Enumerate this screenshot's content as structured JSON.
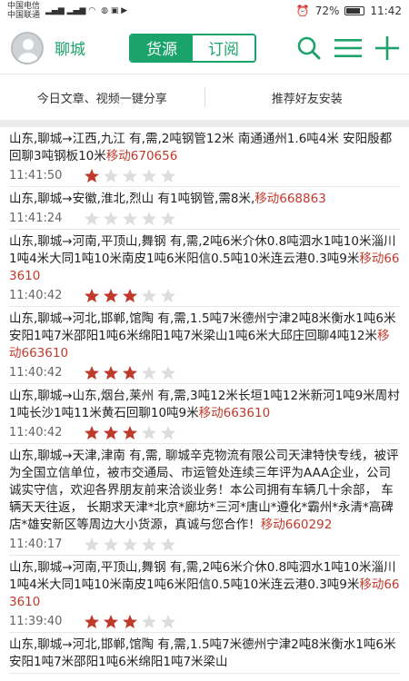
{
  "status_bar": {
    "carrier1": "中国电信",
    "carrier2": "中国联通",
    "battery": "72%",
    "time": "11:42"
  },
  "header": {
    "city": "聊城",
    "tabs": [
      "货源",
      "订阅"
    ],
    "active_tab": 0,
    "icons": [
      "search-icon",
      "menu-icon",
      "add-icon"
    ]
  },
  "share_bar": {
    "left": "今日文章、视频一键分享",
    "right": "推荐好友安装"
  },
  "feed": [
    {
      "text": "山东,聊城→江西,九江 有,需,2吨钢管12米 南通通州1.6吨4米 安阳殷都回聊3吨钢板10米",
      "phone": "移动670656",
      "time": "11:41:50",
      "rating": 1
    },
    {
      "text": "山东,聊城→安徽,淮北,烈山 有1吨钢管,需8米,",
      "phone": "移动668863",
      "time": "11:41:24",
      "rating": 0
    },
    {
      "text": "山东,聊城→河南,平顶山,舞钢 有,需,2吨6米介休0.8吨泗水1吨10米淄川1吨4米大同1吨10米南皮1吨6米阳信0.5吨10米连云港0.3吨9米",
      "phone": "移动663610",
      "time": "11:40:42",
      "rating": 3
    },
    {
      "text": "山东,聊城→河北,邯郸,馆陶 有,需,1.5吨7米德州宁津2吨8米衡水1吨6米安阳1吨7米邵阳1吨6米绵阳1吨7米梁山1吨6米大邱庄回聊4吨12米",
      "phone": "移动663610",
      "time": "11:40:42",
      "rating": 3
    },
    {
      "text": "山东,聊城→山东,烟台,莱州 有,需,3吨12米长垣1吨12米新河1吨9米周村1吨长沙1吨11米黄石回聊10吨9米",
      "phone": "移动663610",
      "time": "11:40:42",
      "rating": 3
    },
    {
      "text": "山东,聊城→天津,津南 有,需, 聊城辛克物流有限公司天津特快专线，被评为全国立信单位，被市交通局、市运管处连续三年评为AAA企业，公司诚实守信，欢迎各界朋友前来洽谈业务！本公司拥有车辆几十余部， 车辆天天往返， 长期求天津*北京*廊坊*三河*唐山*遵化*霸州*永清*高碑店*雄安新区等周边大小货源，真诚与您合作！",
      "phone": "移动660292",
      "time": "11:40:17",
      "rating": 0
    },
    {
      "text": "山东,聊城→河南,平顶山,舞钢 有,需,2吨6米介休0.8吨泗水1吨10米淄川1吨4米大同1吨10米南皮1吨6米阳信0.5吨10米连云港0.3吨9米",
      "phone": "移动663610",
      "time": "11:39:40",
      "rating": 3
    },
    {
      "text": "山东,聊城→河北,邯郸,馆陶 有,需,1.5吨7米德州宁津2吨8米衡水1吨6米安阳1吨7米邵阳1吨6米绵阳1吨7米梁山",
      "phone": "",
      "time": "",
      "rating": 0
    }
  ],
  "colors": {
    "accent": "#1aa36a",
    "phone": "#c0392b",
    "star_on": "#c0392b",
    "star_off": "#dddddd"
  }
}
